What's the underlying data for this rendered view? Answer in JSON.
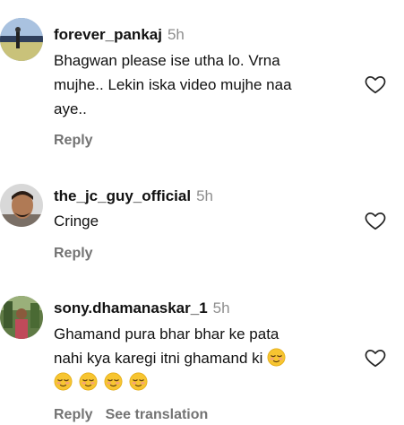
{
  "comments": [
    {
      "username": "forever_pankaj",
      "time": "5h",
      "lines": [
        "Bhagwan please ise utha lo. Vrna",
        "mujhe.. Lekin iska video mujhe naa",
        "aye.."
      ],
      "actions": [
        "Reply"
      ],
      "avatar_icon": "profile-photo-cricket-field"
    },
    {
      "username": "the_jc_guy_official",
      "time": "5h",
      "lines": [
        "Cringe"
      ],
      "actions": [
        "Reply"
      ],
      "avatar_icon": "profile-photo-man-face"
    },
    {
      "username": "sony.dhamanaskar_1",
      "time": "5h",
      "lines": [
        "Ghamand pura bhar bhar ke pata",
        "nahi kya karegi itni ghamand ki"
      ],
      "emoji_count": 5,
      "emoji_icon": "relieved-face-emoji",
      "actions": [
        "Reply",
        "See translation"
      ],
      "avatar_icon": "profile-photo-person-outdoors"
    }
  ],
  "icons": {
    "like": "heart-outline-icon"
  },
  "colors": {
    "text": "#111111",
    "muted": "#737373",
    "timestamp": "#8e8e8e"
  }
}
